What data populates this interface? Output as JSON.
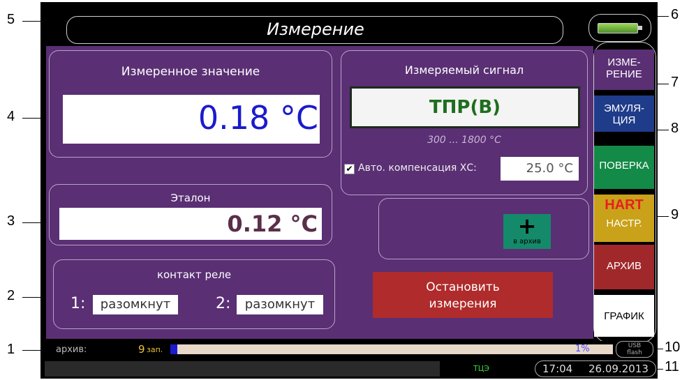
{
  "screen": {
    "title": "Измерение"
  },
  "callouts": [
    "1",
    "2",
    "3",
    "4",
    "5",
    "6",
    "7",
    "8",
    "9",
    "10",
    "11"
  ],
  "measured": {
    "title": "Измеренное значение",
    "value": "0.18 °C"
  },
  "reference": {
    "title": "Эталон",
    "value": "0.12 °C"
  },
  "relay": {
    "title": "контакт реле",
    "items": [
      {
        "label": "1:",
        "value": "разомкнут"
      },
      {
        "label": "2:",
        "value": "разомкнут"
      }
    ]
  },
  "signal": {
    "title": "Измеряемый сигнал",
    "sensor": "ТПР(В)",
    "range": "300 ... 1800  °С",
    "auto_comp_label": "Авто. компенсация ХС:",
    "auto_comp_value": "25.0 °C"
  },
  "archive_button": {
    "label": "в архив"
  },
  "stop_button": {
    "line1": "Остановить",
    "line2": "измерения"
  },
  "tabs": [
    {
      "label1": "ИЗМЕ-",
      "label2": "РЕНИЕ"
    },
    {
      "label1": "ЭМУЛЯ-",
      "label2": "ЦИЯ"
    },
    {
      "label1": "ПОВЕРКА",
      "label2": ""
    },
    {
      "label1": "HART",
      "label2": "НАСТР."
    },
    {
      "label1": "АРХИВ",
      "label2": ""
    },
    {
      "label1": "ГРАФИК",
      "label2": ""
    }
  ],
  "status": {
    "archive_label": "архив:",
    "record_count": "9",
    "record_unit": "зап.",
    "progress_text": "1%",
    "progress_fraction": 0.01,
    "usb_line1": "USB",
    "usb_line2": "flash",
    "time": "17:04",
    "date": "26.09.2013",
    "org": "ТЦЭ"
  },
  "colors": {
    "panel_bg": "#5a2f74",
    "measured_value": "#1a1acc",
    "reference_value": "#5a2f4a",
    "sensor_text": "#1d6e1d",
    "stop_button": "#b02b2b",
    "tab_measure": "#5a2f74",
    "tab_emulation": "#1f3c8a",
    "tab_verify": "#138a47",
    "tab_hart": "#c9a21a",
    "tab_archive": "#a0282b",
    "tab_graph": "#ffffff"
  }
}
